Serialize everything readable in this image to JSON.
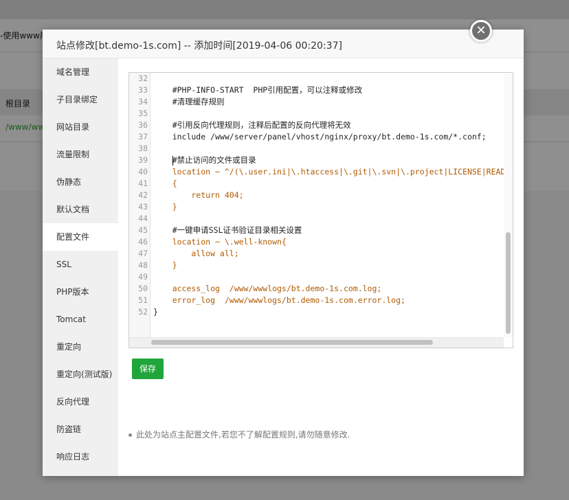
{
  "background": {
    "fragment_top": "-使用www用",
    "col_root_label": "根目录",
    "row_path": "/www/www"
  },
  "modal": {
    "title": "站点修改[bt.demo-1s.com] -- 添加时间[2019-04-06 00:20:37]",
    "close_glyph": "✕"
  },
  "sidebar": {
    "active_index": 6,
    "items": [
      {
        "label": "域名管理"
      },
      {
        "label": "子目录绑定"
      },
      {
        "label": "网站目录"
      },
      {
        "label": "流量限制"
      },
      {
        "label": "伪静态"
      },
      {
        "label": "默认文档"
      },
      {
        "label": "配置文件"
      },
      {
        "label": "SSL"
      },
      {
        "label": "PHP版本"
      },
      {
        "label": "Tomcat"
      },
      {
        "label": "重定向"
      },
      {
        "label": "重定向(测试版)"
      },
      {
        "label": "反向代理"
      },
      {
        "label": "防盗链"
      },
      {
        "label": "响应日志"
      }
    ]
  },
  "editor": {
    "lines": [
      {
        "n": "32",
        "text": ""
      },
      {
        "n": "33",
        "text": "    #PHP-INFO-START  PHP引用配置，可以注释或修改"
      },
      {
        "n": "34",
        "text": "    #清理缓存规则"
      },
      {
        "n": "35",
        "text": ""
      },
      {
        "n": "36",
        "text": "    #引用反向代理规则，注释后配置的反向代理将无效"
      },
      {
        "n": "37",
        "text": "    include /www/server/panel/vhost/nginx/proxy/bt.demo-1s.com/*.conf;"
      },
      {
        "n": "38",
        "text": ""
      },
      {
        "n": "39",
        "text": "    #禁止访问的文件或目录"
      },
      {
        "n": "40",
        "text": "    location ~ ^/(\\.user.ini|\\.htaccess|\\.git|\\.svn|\\.project|LICENSE|README.md)"
      },
      {
        "n": "41",
        "text": "    {"
      },
      {
        "n": "42",
        "text": "        return 404;"
      },
      {
        "n": "43",
        "text": "    }"
      },
      {
        "n": "44",
        "text": ""
      },
      {
        "n": "45",
        "text": "    #一键申请SSL证书验证目录相关设置"
      },
      {
        "n": "46",
        "text": "    location ~ \\.well-known{"
      },
      {
        "n": "47",
        "text": "        allow all;"
      },
      {
        "n": "48",
        "text": "    }"
      },
      {
        "n": "49",
        "text": ""
      },
      {
        "n": "50",
        "text": "    access_log  /www/wwwlogs/bt.demo-1s.com.log;"
      },
      {
        "n": "51",
        "text": "    error_log  /www/wwwlogs/bt.demo-1s.com.error.log;"
      },
      {
        "n": "52",
        "text": "}"
      }
    ]
  },
  "actions": {
    "save_label": "保存"
  },
  "tip": {
    "text": "此处为站点主配置文件,若您不了解配置规则,请勿随意修改."
  },
  "colors": {
    "accent": "#20a53a",
    "directive": "#b15a00"
  }
}
